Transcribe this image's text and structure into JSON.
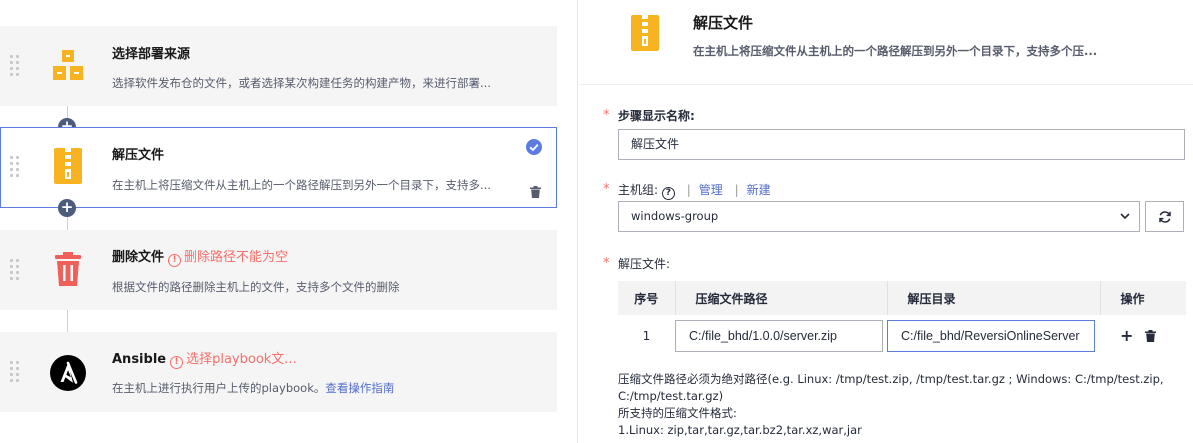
{
  "steps": [
    {
      "title": "选择部署来源",
      "desc": "选择软件发布仓的文件，或者选择某次构建任务的构建产物，来进行部署...",
      "error": "",
      "icon": "package-icon"
    },
    {
      "title": "解压文件",
      "desc": "在主机上将压缩文件从主机上的一个路径解压到另外一个目录下，支持多...",
      "error": "",
      "icon": "zip-file-icon"
    },
    {
      "title": "删除文件",
      "desc": "根据文件的路径删除主机上的文件，支持多个文件的删除",
      "error": "删除路径不能为空",
      "icon": "trash-icon"
    },
    {
      "title": "Ansible",
      "desc": "在主机上进行执行用户上传的playbook。",
      "desc_link": "查看操作指南",
      "error": "选择playbook文...",
      "icon": "ansible-icon"
    }
  ],
  "colors": {
    "accent": "#5e7ce0",
    "error": "#f66f6a",
    "package_yellow": "#f8b320",
    "trash_red": "#f0605a",
    "plus_dark": "#4d5b7c"
  },
  "detail": {
    "title": "解压文件",
    "desc": "在主机上将压缩文件从主机上的一个路径解压到另外一个目录下，支持多个压...",
    "required_mark": "*",
    "name_label": "步骤显示名称:",
    "name_value": "解压文件",
    "host_label": "主机组:",
    "help_glyph": "?",
    "divider": "|",
    "manage_link": "管理",
    "create_link": "新建",
    "host_value": "windows-group",
    "unzip_label": "解压文件:",
    "table_headers": [
      "序号",
      "压缩文件路径",
      "解压目录",
      "操作"
    ],
    "rows": [
      {
        "index": "1",
        "source": "C:/file_bhd/1.0.0/server.zip",
        "target": "C:/file_bhd/ReversiOnlineServer"
      }
    ],
    "add_glyph": "+",
    "notes": [
      "压缩文件路径必须为绝对路径(e.g. Linux: /tmp/test.zip, /tmp/test.tar.gz ; Windows: C:/tmp/test.zip,",
      "C:/tmp/test.tar.gz)",
      "所支持的压缩文件格式:",
      "1.Linux: zip,tar,tar.gz,tar.bz2,tar.xz,war,jar"
    ]
  }
}
